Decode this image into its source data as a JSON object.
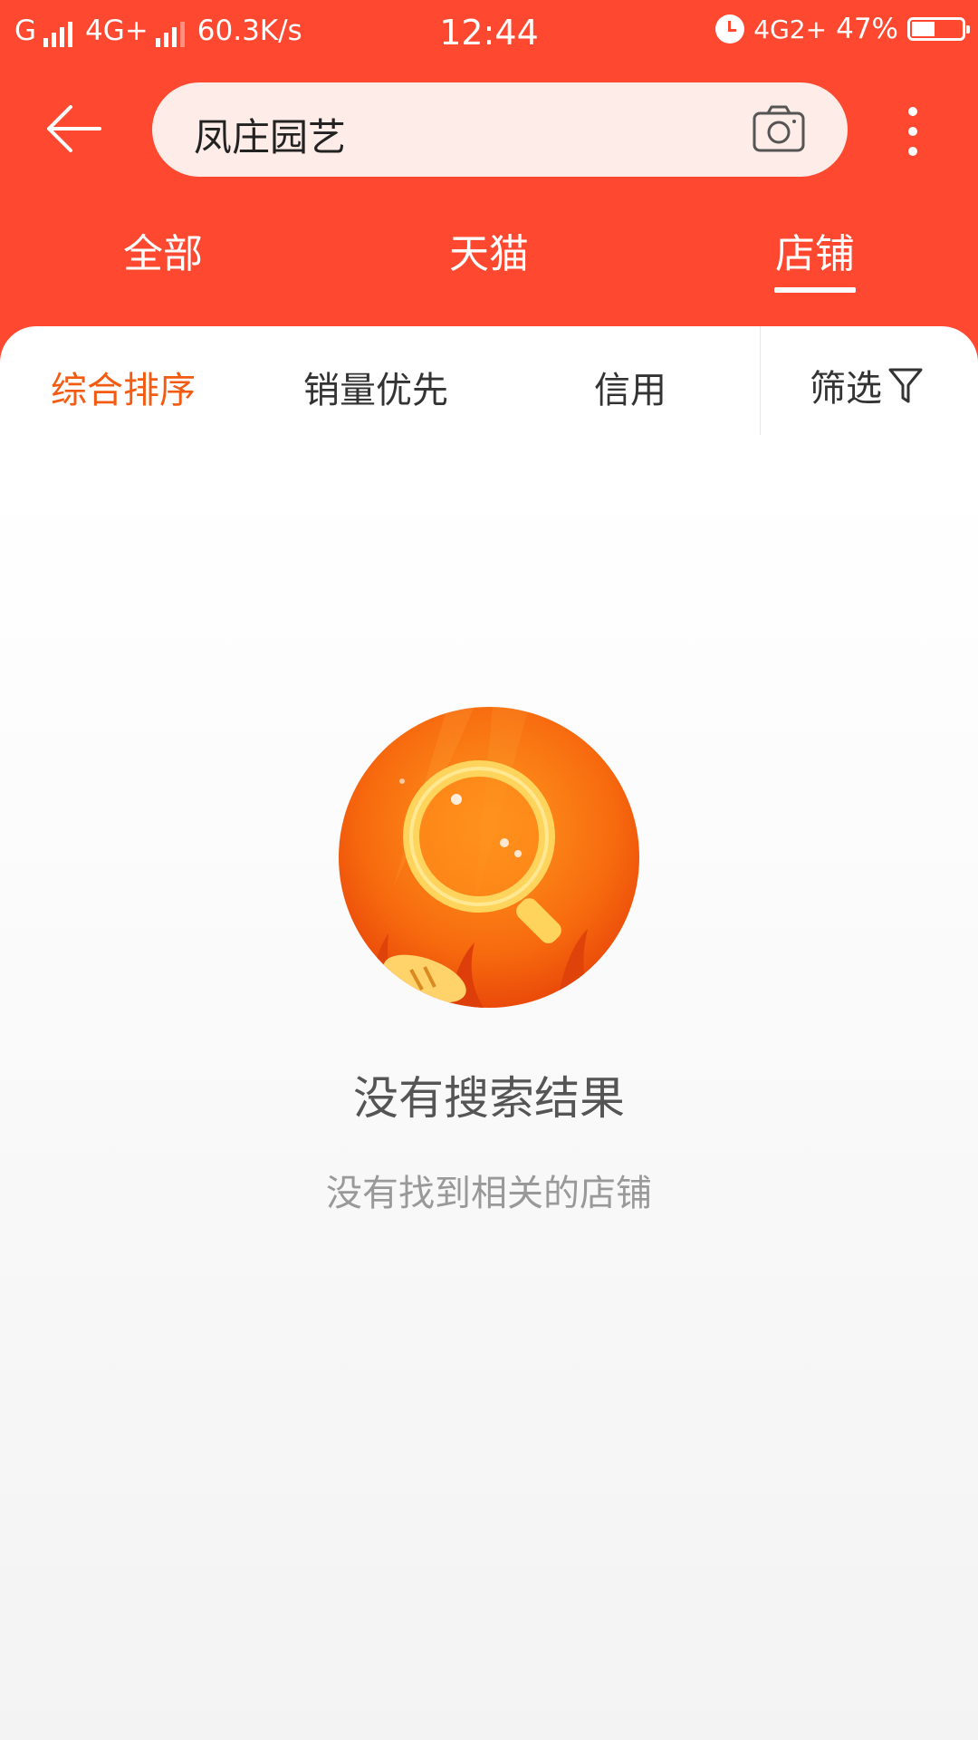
{
  "status_bar": {
    "carrier": "G",
    "network": "4G+",
    "speed": "60.3K/s",
    "time": "12:44",
    "network2": "4G2+",
    "battery": "47%",
    "battery_level": 0.47
  },
  "search": {
    "query": "凤庄园艺"
  },
  "tabs": [
    {
      "label": "全部"
    },
    {
      "label": "天猫"
    },
    {
      "label": "店铺",
      "active": true
    }
  ],
  "sort": {
    "items": [
      {
        "label": "综合排序",
        "active": true
      },
      {
        "label": "销量优先"
      },
      {
        "label": "信用"
      }
    ],
    "filter_label": "筛选"
  },
  "empty_state": {
    "title": "没有搜索结果",
    "subtitle": "没有找到相关的店铺"
  },
  "colors": {
    "brand": "#fe4830",
    "active_sort": "#f45b12",
    "search_bg": "#fdece7"
  },
  "icons": [
    "back-arrow-icon",
    "camera-icon",
    "more-vertical-icon",
    "filter-funnel-icon",
    "alarm-icon",
    "battery-icon",
    "signal-icon"
  ]
}
